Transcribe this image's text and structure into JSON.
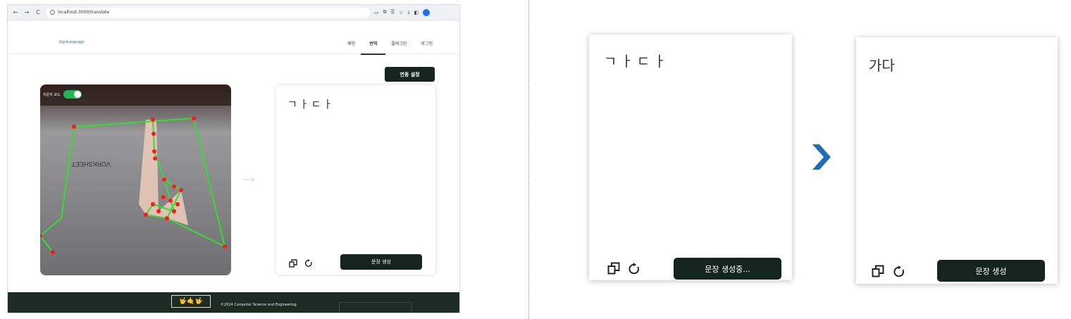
{
  "browser": {
    "url": "localhost:3000/translate",
    "nav_back": "←",
    "nav_forward": "→",
    "nav_reload": "C",
    "extensions": [
      "▭",
      "⧉",
      "⎘",
      "☆",
      "⤓",
      "◧"
    ],
    "profile_glyph": "●"
  },
  "site": {
    "logo_text": "SignLanguage",
    "nav": {
      "main": "메인",
      "translate": "번역",
      "plugin": "플러그인",
      "login": "로그인"
    },
    "sync_settings_label": "연동 설정",
    "sign_mode_label": "지문자 모드",
    "sign_mode_on": true,
    "arrow_glyph": "→",
    "output_text": "ㄱㅏㄷㅏ",
    "generate_label": "문장 생성",
    "footer_logo": "🤟🤙🤟",
    "copyright": "©2024 Computer Science and Engineering"
  },
  "panels": {
    "before": {
      "text": "ㄱㅏㄷㅏ",
      "button_label": "문장 생성중..."
    },
    "after": {
      "text": "가다",
      "button_label": "문장 생성"
    }
  },
  "colors": {
    "button_bg": "#13251e",
    "toggle_on": "#22b455",
    "chevron": "#1f6fb2",
    "footer_bg": "#1c2c22",
    "landmark_point": "#ff1a1a",
    "landmark_line": "#33dd33"
  },
  "icons": {
    "copy": "copy-icon",
    "refresh": "refresh-icon",
    "next": "chevron-right-icon"
  }
}
